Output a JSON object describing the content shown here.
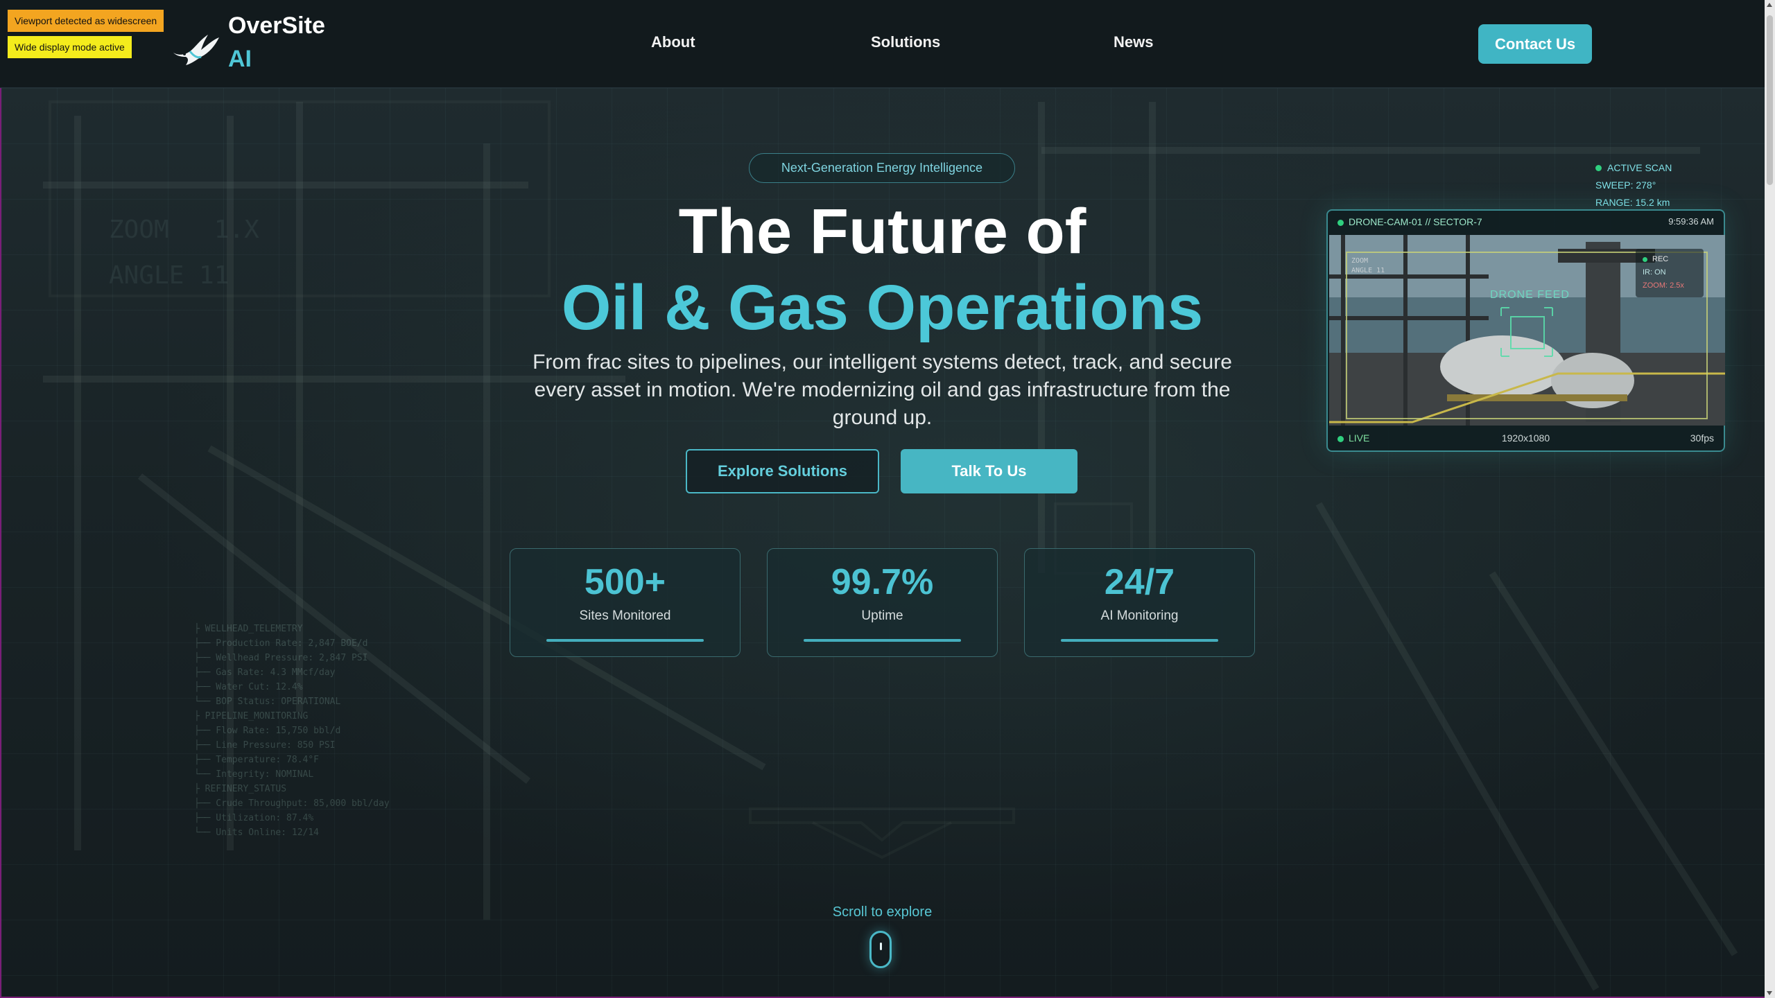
{
  "debug": {
    "line1": "Viewport detected as widescreen",
    "line2": "Wide display mode active"
  },
  "brand": {
    "name_line1": "OverSite",
    "name_line2": "AI",
    "logo_icon": "hummingbird-icon"
  },
  "nav": {
    "items": [
      {
        "label": "About"
      },
      {
        "label": "Solutions"
      },
      {
        "label": "News"
      }
    ],
    "contact_label": "Contact Us"
  },
  "hero": {
    "badge": "Next-Generation Energy Intelligence",
    "title_line1": "The Future of",
    "title_line2": "Oil & Gas Operations",
    "subtitle": "From frac sites to pipelines, our intelligent systems detect, track, and secure every asset in motion. We're modernizing oil and gas infrastructure from the ground up.",
    "primary_button": "Explore Solutions",
    "secondary_button": "Talk To Us"
  },
  "stats": [
    {
      "value": "500+",
      "label": "Sites Monitored"
    },
    {
      "value": "99.7%",
      "label": "Uptime"
    },
    {
      "value": "24/7",
      "label": "AI Monitoring"
    }
  ],
  "scan": {
    "status": "ACTIVE SCAN",
    "sweep": "SWEEP: 278°",
    "range": "RANGE: 15.2 km"
  },
  "camera": {
    "title": "DRONE-CAM-01 // SECTOR-7",
    "time": "9:59:36 AM",
    "feed_label": "DRONE FEED",
    "rec": "REC",
    "ir": "IR: ON",
    "zoom": "ZOOM: 2.5x",
    "live": "LIVE",
    "resolution": "1920x1080",
    "fps": "30fps"
  },
  "scroll": {
    "label": "Scroll to explore"
  },
  "colors": {
    "accent": "#4cc8d8",
    "button": "#40b5c4",
    "live": "#2fd07f",
    "background": "#121b1f"
  }
}
